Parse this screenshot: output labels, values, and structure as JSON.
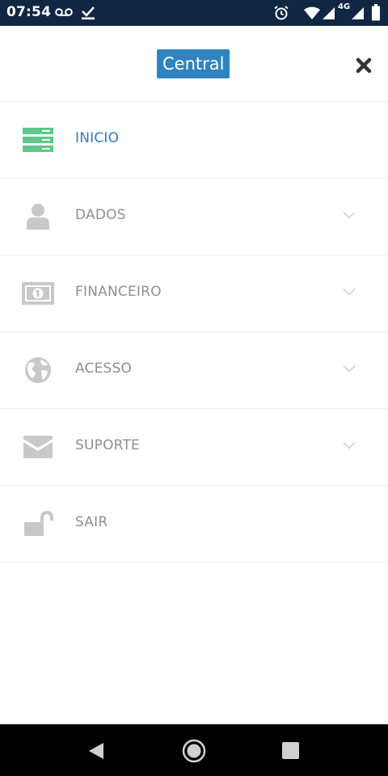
{
  "status_bar": {
    "time": "07:54",
    "network": "4G",
    "icons": [
      "voicemail-icon",
      "download-done-icon",
      "alarm-icon",
      "wifi-icon",
      "signal-icon",
      "battery-icon"
    ]
  },
  "header": {
    "brand_label": "Central",
    "close_icon": "close-icon"
  },
  "menu": {
    "items": [
      {
        "label": "INICIO",
        "icon": "servers-icon",
        "active": true,
        "expandable": false
      },
      {
        "label": "DADOS",
        "icon": "user-icon",
        "active": false,
        "expandable": true
      },
      {
        "label": "FINANCEIRO",
        "icon": "banknote-icon",
        "active": false,
        "expandable": true
      },
      {
        "label": "ACESSO",
        "icon": "globe-icon",
        "active": false,
        "expandable": true
      },
      {
        "label": "SUPORTE",
        "icon": "envelope-icon",
        "active": false,
        "expandable": true
      },
      {
        "label": "SAIR",
        "icon": "unlock-icon",
        "active": false,
        "expandable": false
      }
    ]
  },
  "colors": {
    "status_bar": "#0f2742",
    "brand_bg": "#2f84bf",
    "active_text": "#2d7db6",
    "active_icon": "#5cc98a",
    "inactive": "#c8c8c8"
  }
}
